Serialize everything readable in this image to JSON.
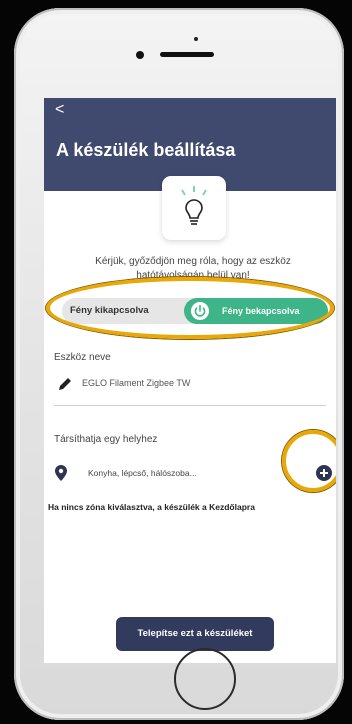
{
  "header": {
    "back_glyph": "<",
    "title": "A készülék beállítása"
  },
  "description": "Kérjük, győződjön meg róla, hogy az eszköz hatótávolságán belül van!",
  "toggle": {
    "off_label": "Fény kikapcsolva",
    "on_label": "Fény bekapcsolva",
    "state": "on",
    "active_color": "#3eb489"
  },
  "device": {
    "label": "Eszköz neve",
    "name": "EGLO Filament Zigbee TW"
  },
  "room": {
    "label": "Társíthatja egy helyhez",
    "placeholder": "Konyha, lépcső, hálószoba...",
    "hint": "Ha nincs zóna kiválasztva, a készülék a Kezdőlapra"
  },
  "install_button_label": "Telepítse ezt a készüléket",
  "colors": {
    "header": "#3f4a6e",
    "button": "#323b5e",
    "highlight": "#e7a808"
  },
  "icons": [
    "lightbulb-icon",
    "power-icon",
    "pencil-icon",
    "location-pin-icon",
    "add-circle-icon"
  ]
}
